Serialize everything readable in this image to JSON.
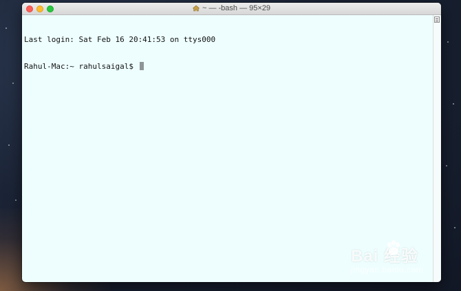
{
  "window": {
    "title": "~ — -bash — 95×29",
    "title_icon": "home-icon"
  },
  "terminal": {
    "lines": [
      "Last login: Sat Feb 16 20:41:53 on ttys000",
      "Rahul-Mac:~ rahulsaigal$ "
    ]
  },
  "watermark": {
    "brand": "Bai  经验",
    "url": "jingyan.baidu.com"
  },
  "colors": {
    "terminal_bg": "#eefefe",
    "close": "#fc5f57",
    "minimize": "#fdbc2e",
    "maximize": "#28c840"
  }
}
